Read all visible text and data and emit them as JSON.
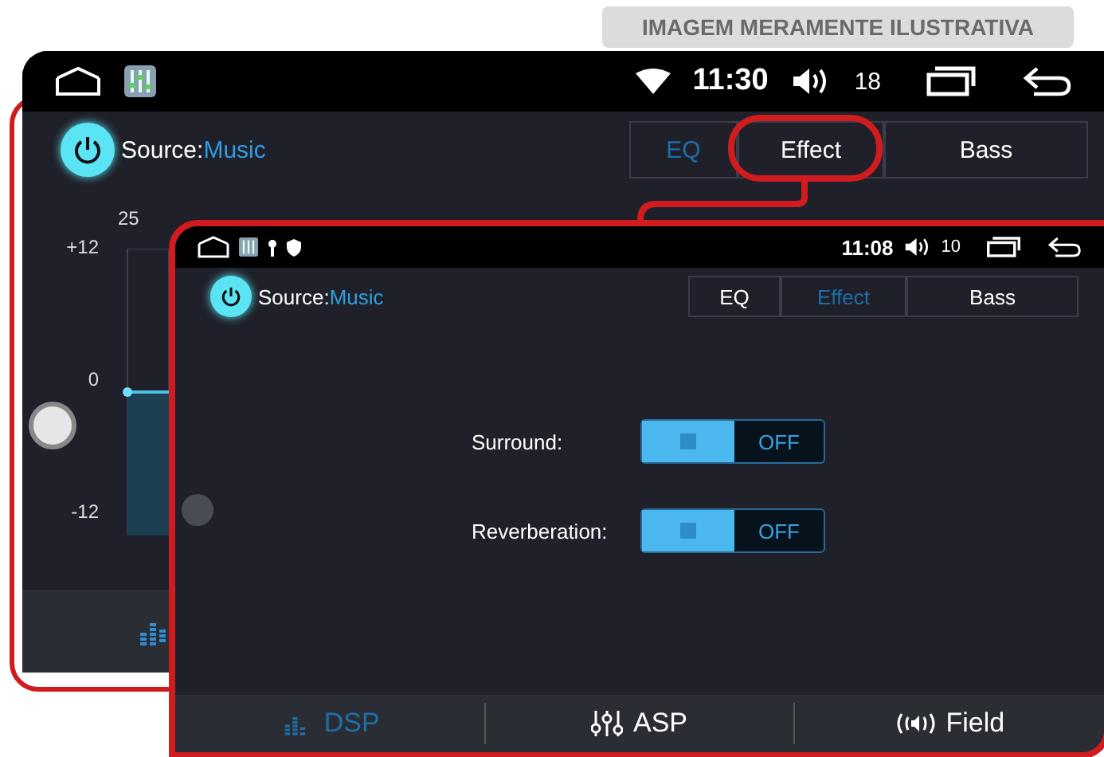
{
  "label": "IMAGEM MERAMENTE ILUSTRATIVA",
  "back_screen": {
    "status_bar": {
      "time": "11:30",
      "volume": "18"
    },
    "source": {
      "label": "Source:",
      "value": "Music"
    },
    "tabs": [
      {
        "label": "EQ",
        "selected": true
      },
      {
        "label": "Effect",
        "selected": false
      },
      {
        "label": "Bass",
        "selected": false
      }
    ],
    "eq_chart": {
      "band_label": "25",
      "axis_labels": [
        "+12",
        "0",
        "-12"
      ]
    }
  },
  "front_screen": {
    "status_bar": {
      "time": "11:08",
      "volume": "10"
    },
    "source": {
      "label": "Source:",
      "value": "Music"
    },
    "tabs": [
      {
        "label": "EQ",
        "selected": false
      },
      {
        "label": "Effect",
        "selected": true
      },
      {
        "label": "Bass",
        "selected": false
      }
    ],
    "settings": [
      {
        "label": "Surround:",
        "on": false,
        "state_text": "OFF"
      },
      {
        "label": "Reverberation:",
        "on": false,
        "state_text": "OFF"
      }
    ],
    "bottom_tabs": [
      {
        "kind": "bars",
        "label": "DSP",
        "selected": true
      },
      {
        "kind": "sliders",
        "label": "ASP",
        "selected": false
      },
      {
        "kind": "speaker",
        "label": "Field",
        "selected": false
      }
    ]
  }
}
